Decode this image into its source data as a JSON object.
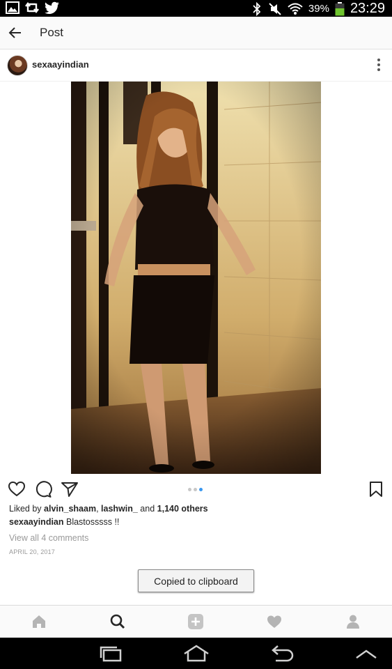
{
  "status_bar": {
    "battery_percent": "39%",
    "time": "23:29",
    "left_icons": [
      "image-icon",
      "retweet-icon",
      "twitter-icon"
    ],
    "right_icons": [
      "bluetooth-icon",
      "mute-icon",
      "wifi-icon",
      "battery-icon"
    ],
    "battery_color": "#6fc52f"
  },
  "header": {
    "title": "Post"
  },
  "post": {
    "username": "sexaayindian",
    "carousel": {
      "count": 3,
      "active_index": 2,
      "active_color": "#3897f0"
    },
    "likes": {
      "prefix": "Liked by ",
      "user1": "alvin_shaam",
      "separator": ", ",
      "user2": "lashwin_",
      "and_text": " and ",
      "others": "1,140 others"
    },
    "caption": {
      "username": "sexaayindian",
      "text": " Blastosssss !!"
    },
    "comments_link": "View all 4 comments",
    "date": "APRIL 20, 2017"
  },
  "toast": "Copied to clipboard",
  "bottom_nav": [
    "home-icon",
    "search-icon",
    "add-post-icon",
    "activity-heart-icon",
    "profile-icon"
  ],
  "system_nav": [
    "recent-apps-icon",
    "home-icon",
    "back-icon",
    "collapse-icon"
  ]
}
